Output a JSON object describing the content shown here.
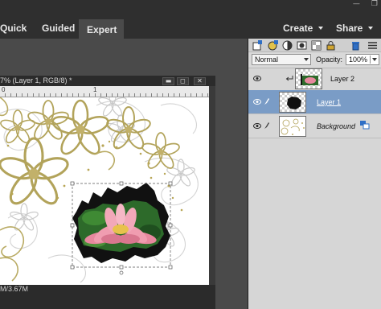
{
  "window_controls": [
    "—",
    "❐"
  ],
  "mode_tabs": {
    "quick": "Quick",
    "guided": "Guided",
    "expert": "Expert",
    "active": "Expert"
  },
  "actions": {
    "create": "Create",
    "share": "Share"
  },
  "document": {
    "title": "7% (Layer 1, RGB/8) *",
    "controls": [
      "▬",
      "◻",
      "✕"
    ],
    "ruler_numbers": [
      "0",
      "1"
    ],
    "status": "M/3.67M"
  },
  "layers_panel": {
    "blend_mode": "Normal",
    "opacity_label": "Opacity:",
    "opacity_value": "100%",
    "layers": [
      {
        "name": "Layer 2",
        "visible": true,
        "selected": false,
        "thumbnail": "flower-crop-thumbnail"
      },
      {
        "name": "Layer 1",
        "visible": true,
        "selected": true,
        "thumbnail": "black-mask-thumbnail"
      },
      {
        "name": "Background",
        "visible": true,
        "selected": false,
        "thumbnail": "floral-background-thumbnail",
        "locked": true
      }
    ]
  },
  "colors": {
    "top_bar": "#2f2f2f",
    "workspace": "#4a4a4a",
    "panel": "#d6d6d6",
    "selected_layer": "#7a9cc6",
    "accent_blue": "#2f6fc6"
  }
}
